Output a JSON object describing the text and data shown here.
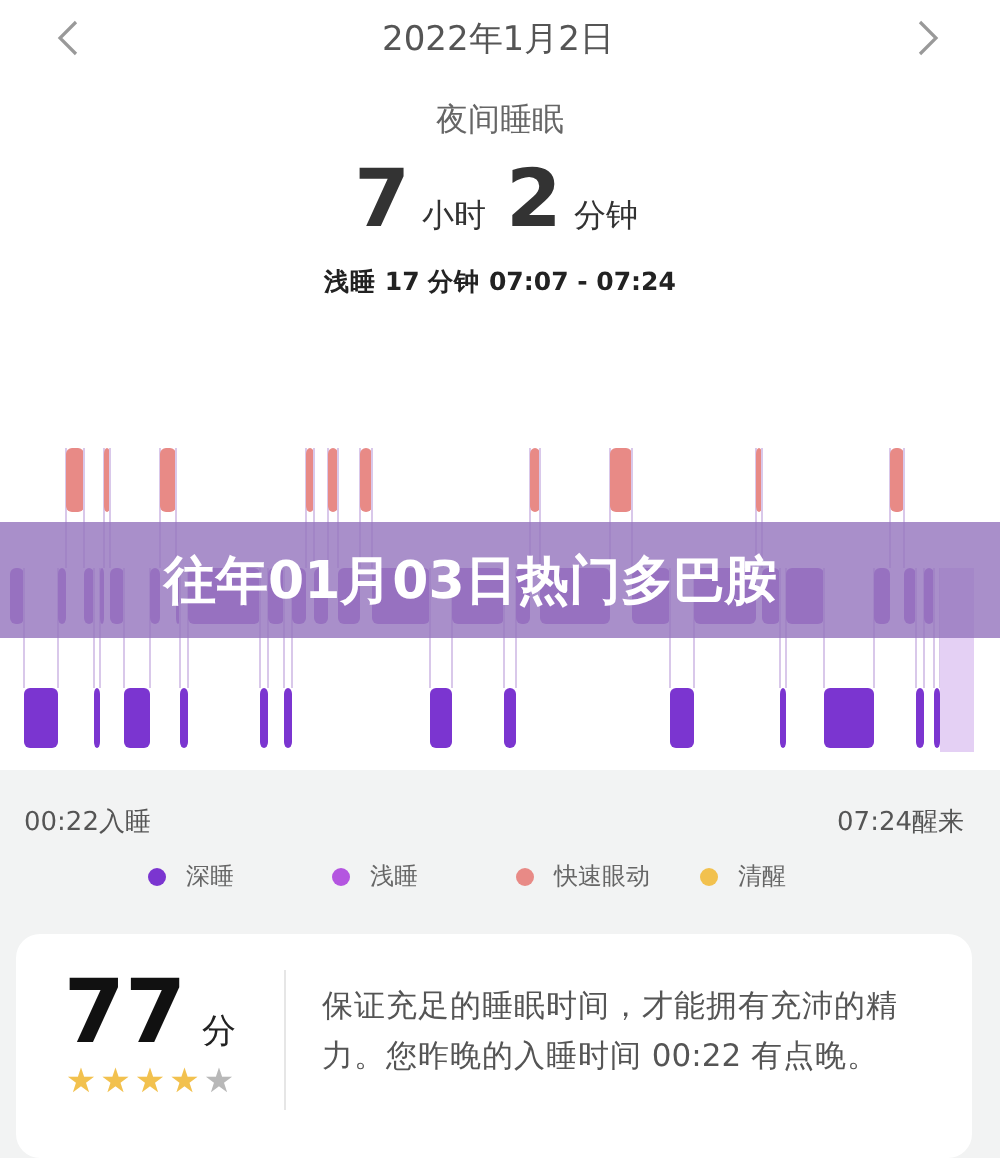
{
  "header": {
    "date": "2022年1月2日"
  },
  "summary": {
    "title": "夜间睡眠",
    "hours": "7",
    "hours_unit": "小时",
    "minutes": "2",
    "minutes_unit": "分钟",
    "selection": "浅睡 17 分钟 07:07 - 07:24"
  },
  "banner": {
    "text": "往年01月03日热门多巴胺"
  },
  "timeline": {
    "start": "00:22入睡",
    "end": "07:24醒来"
  },
  "legend": [
    {
      "label": "深睡",
      "color": "#7b35d0"
    },
    {
      "label": "浅睡",
      "color": "#b455e0"
    },
    {
      "label": "快速眼动",
      "color": "#e88a86"
    },
    {
      "label": "清醒",
      "color": "#f2c14e"
    }
  ],
  "score": {
    "value": "77",
    "unit": "分",
    "stars": 4,
    "advice": "保证充足的睡眠时间，才能拥有充沛的精力。您昨晚的入睡时间 00:22 有点晚。"
  }
}
